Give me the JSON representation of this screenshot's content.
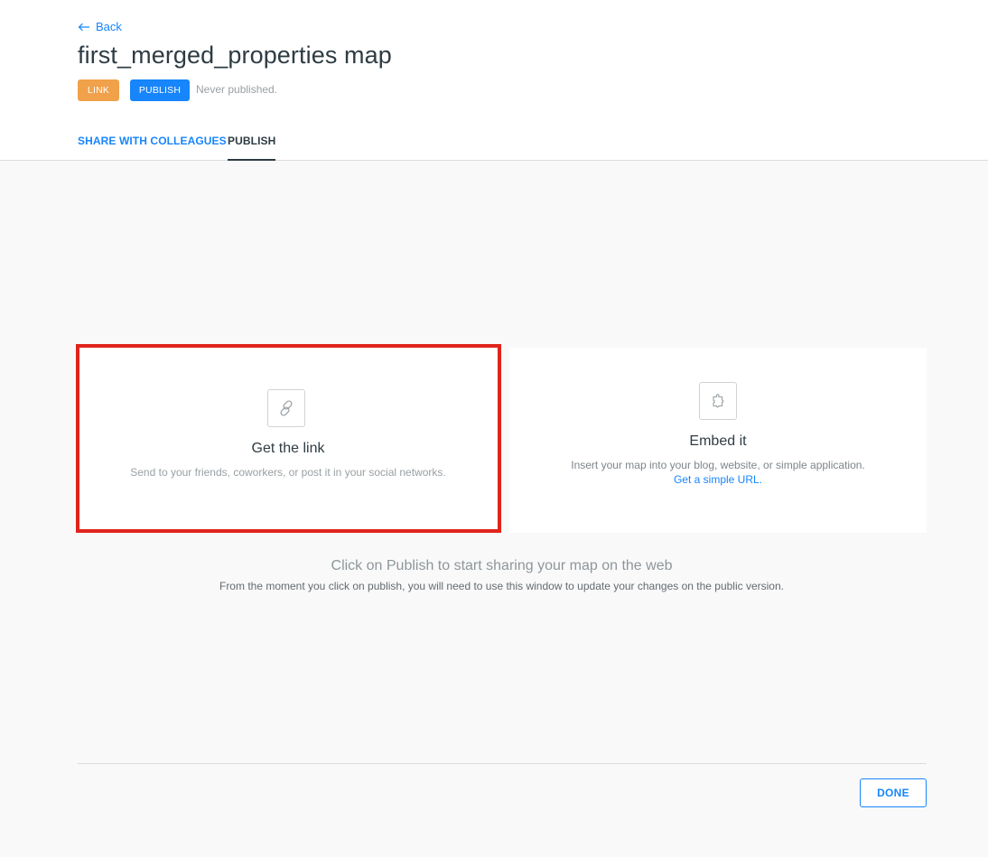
{
  "header": {
    "back_label": "Back",
    "title": "first_merged_properties map",
    "badges": {
      "link": "LINK",
      "publish": "PUBLISH"
    },
    "status": "Never published."
  },
  "tabs": [
    {
      "label": "SHARE WITH COLLEAGUES",
      "active": false
    },
    {
      "label": "PUBLISH",
      "active": true
    }
  ],
  "cards": {
    "link": {
      "icon": "link-icon",
      "title": "Get the link",
      "description": "Send to your friends, coworkers, or post it in your social networks."
    },
    "embed": {
      "icon": "puzzle-icon",
      "title": "Embed it",
      "description": "Insert your map into your blog, website, or simple application.",
      "link_label": "Get a simple URL."
    }
  },
  "info": {
    "title": "Click on Publish to start sharing your map on the web",
    "subtitle": "From the moment you click on publish, you will need to use this window to update your changes on the public version."
  },
  "footer": {
    "done_label": "DONE"
  },
  "colors": {
    "accent": "#1785fb",
    "link_badge": "#f0a14a",
    "highlight": "#e0241c",
    "background": "#f9f9f9"
  }
}
